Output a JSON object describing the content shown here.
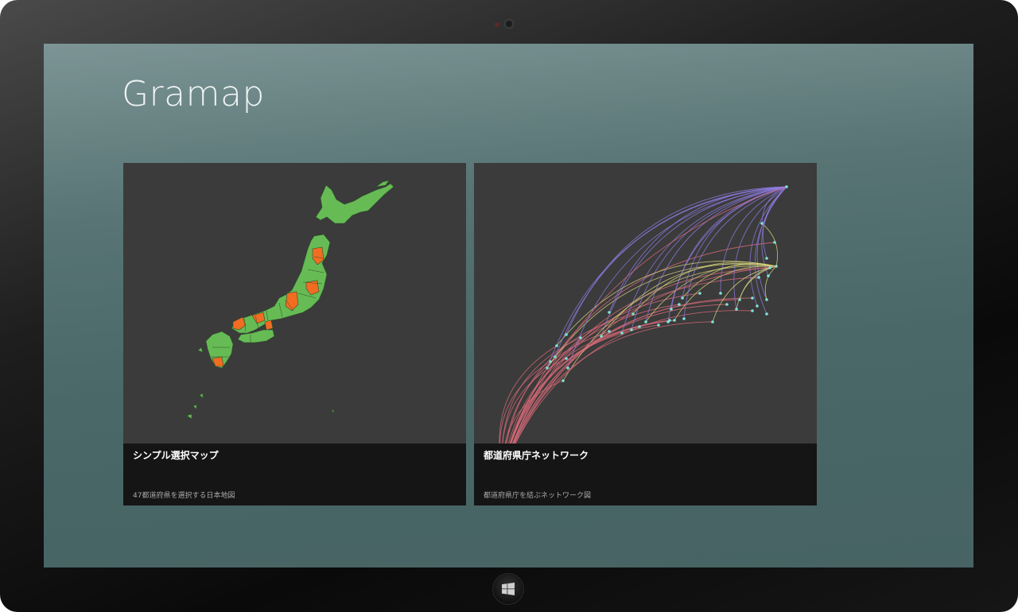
{
  "app": {
    "title": "Gramap"
  },
  "tiles": [
    {
      "title": "シンプル選択マップ",
      "subtitle": "47都道府県を選択する日本地図"
    },
    {
      "title": "都道府県庁ネットワーク",
      "subtitle": "都道府県庁を結ぶネットワーク図"
    }
  ],
  "colors": {
    "map_land": "#66bb55",
    "map_selected": "#f26c22",
    "node": "#7fe3d8",
    "arc_hot": "#d86a78",
    "arc_cool": "#8f7ae0",
    "arc_yellow": "#d6d27a"
  },
  "icons": {
    "hardware_button": "windows-logo-icon"
  }
}
